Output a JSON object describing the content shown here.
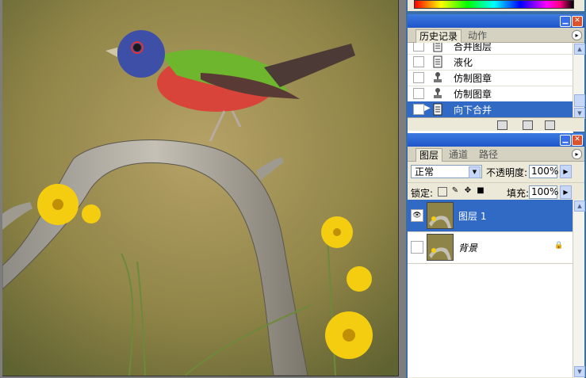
{
  "history_panel": {
    "tabs": [
      "历史记录",
      "动作"
    ],
    "items": [
      {
        "label": "合并图层",
        "icon": "document-icon",
        "selected": false
      },
      {
        "label": "液化",
        "icon": "document-icon",
        "selected": false
      },
      {
        "label": "仿制图章",
        "icon": "stamp-icon",
        "selected": false
      },
      {
        "label": "仿制图章",
        "icon": "stamp-icon",
        "selected": false
      },
      {
        "label": "向下合并",
        "icon": "document-icon",
        "selected": true
      }
    ]
  },
  "layers_panel": {
    "tabs": [
      "图层",
      "通道",
      "路径"
    ],
    "blend_mode": "正常",
    "opacity_label": "不透明度:",
    "opacity_value": "100%",
    "lock_label": "锁定:",
    "fill_label": "填充:",
    "fill_value": "100%",
    "layers": [
      {
        "name": "图层 1",
        "visible": true,
        "selected": true,
        "locked": false
      },
      {
        "name": "背景",
        "visible": false,
        "selected": false,
        "locked": true
      }
    ]
  },
  "colors": {
    "selection": "#316ac5",
    "panel_bg": "#ece9d8",
    "titlebar": "#1f55c9"
  }
}
